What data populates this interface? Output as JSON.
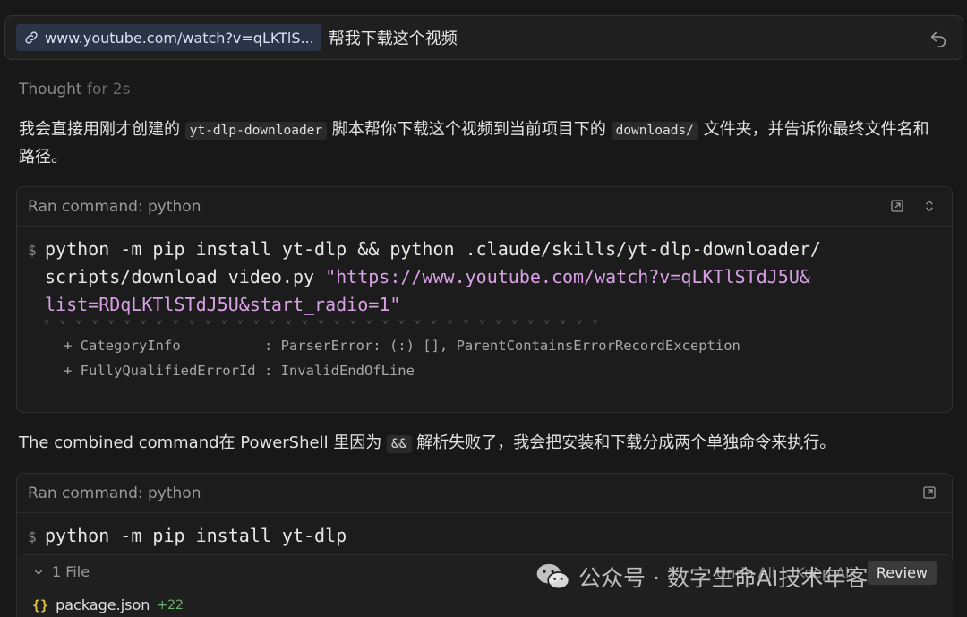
{
  "prompt": {
    "link_chip": "www.youtube.com/watch?v=qLKTlS...",
    "text": "帮我下载这个视频",
    "undo_icon": "undo-icon"
  },
  "thought": {
    "label": "Thought",
    "duration": "for 2s"
  },
  "message1": {
    "part1": "我会直接用刚才创建的 ",
    "code1": "yt-dlp-downloader",
    "part2": " 脚本帮你下载这个视频到当前项目下的 ",
    "code2": "downloads/",
    "part3": " 文件夹，并告诉你最终文件名和路径。"
  },
  "command1": {
    "title": "Ran command: python",
    "prompt_symbol": "$",
    "line1": "python -m pip install yt-dlp && python .claude/skills/yt-dlp-downloader/",
    "line2": "scripts/download_video.py ",
    "line2_str": "\"https://www.youtube.com/watch?v=qLKTlSTdJ5U&",
    "line3_str": "list=RDqLKTlSTdJ5U&start_radio=1\"",
    "truncated_marker": "˅ ˅ ˅ ˅ ˅ ˅ ˅ ˅ ˅ ˅ ˅ ˅ ˅ ˅ ˅ ˅ ˅ ˅ ˅ ˅ ˅ ˅ ˅ ˅ ˅ ˅ ˅ ˅ ˅ ˅ ˅ ˅ ˅ ˅ ˅",
    "err1": "+ CategoryInfo          : ParserError: (:) [], ParentContainsErrorRecordException",
    "err2": "+ FullyQualifiedErrorId : InvalidEndOfLine"
  },
  "message2": {
    "part1": "The combined command在 PowerShell 里因为 ",
    "code1": "&&",
    "part2": " 解析失败了，我会把安装和下载分成两个单独命令来执行。"
  },
  "command2": {
    "title": "Ran command: python",
    "prompt_symbol": "$",
    "line1": "python -m pip install yt-dlp"
  },
  "files": {
    "count_label": "1 File",
    "items": [
      {
        "icon": "{}",
        "name": "package.json",
        "added": "+22"
      }
    ],
    "undo_all": "Undo All",
    "keep_all": "Keep All",
    "review": "Review"
  },
  "watermark": {
    "text": "公众号 · 数字生命AI技术年客"
  },
  "colors": {
    "background": "#181818",
    "string": "#d9a0e6",
    "chip": "#2c3547",
    "added": "#6ab06a"
  }
}
